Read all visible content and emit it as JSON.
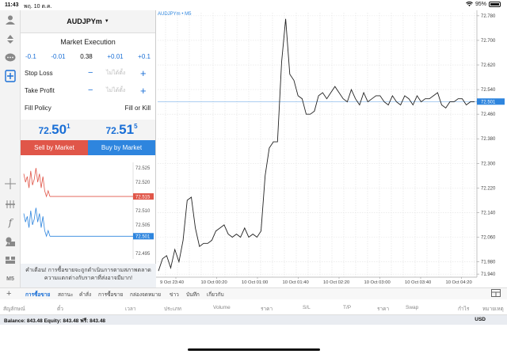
{
  "status": {
    "time": "11:43",
    "date": "พฤ. 10 ต.ค.",
    "battery": "95%"
  },
  "toolbar": {
    "timeframe": "M5"
  },
  "order": {
    "symbol": "AUDJPYm",
    "execution": "Market Execution",
    "volume_steps": [
      "-0.1",
      "-0.01",
      "0.38",
      "+0.01",
      "+0.1"
    ],
    "stop_loss_label": "Stop Loss",
    "take_profit_label": "Take Profit",
    "placeholder": "ไม่ได้ตั้ง",
    "fill_policy_label": "Fill Policy",
    "fill_policy_value": "Fill or Kill",
    "sell_price": {
      "small": "72.",
      "big": "50",
      "sup": "1"
    },
    "buy_price": {
      "small": "72.",
      "big": "51",
      "sup": "5"
    },
    "sell_label": "Sell by Market",
    "buy_label": "Buy by Market",
    "warning": "คำเตือน! การซื้อขายจะถูกดำเนินการตามสภาพตลาด ความแตกต่างกับราคาที่ส่งอาจมีมาก!"
  },
  "mini_chart": {
    "ticks": [
      "72.525",
      "72.520",
      "72.515",
      "72.510",
      "72.505",
      "72.501",
      "72.495"
    ],
    "ask_label": "72.515",
    "bid_label": "72.501",
    "colors": {
      "ask": "#e05649",
      "bid": "#2e85de"
    }
  },
  "chart": {
    "title": "AUDJPYm • M5",
    "y_ticks": [
      "72.780",
      "72.700",
      "72.620",
      "72.540",
      "72.460",
      "72.380",
      "72.300",
      "72.220",
      "72.140",
      "72.060",
      "71.980",
      "71.940"
    ],
    "x_labels": [
      "9 Oct 23:40",
      "10 Oct 00:20",
      "10 Oct 01:00",
      "10 Oct 01:40",
      "10 Oct 02:20",
      "10 Oct 03:00",
      "10 Oct 03:40",
      "10 Oct 04:20"
    ],
    "price_label": "72.501",
    "price_color": "#2e85de"
  },
  "chart_data": {
    "type": "line",
    "title": "AUDJPYm • M5",
    "xlabel": "",
    "ylabel": "",
    "ylim": [
      71.93,
      72.79
    ],
    "last_price": 72.501,
    "x_ticks": [
      "9 Oct 23:40",
      "10 Oct 00:20",
      "10 Oct 01:00",
      "10 Oct 01:40",
      "10 Oct 02:20",
      "10 Oct 03:00",
      "10 Oct 03:40",
      "10 Oct 04:20"
    ],
    "series": [
      {
        "values": [
          71.95,
          71.99,
          72.0,
          71.96,
          72.02,
          71.98,
          72.05,
          72.18,
          72.19,
          72.09,
          72.03,
          72.04,
          72.04,
          72.05,
          72.08,
          72.09,
          72.1,
          72.07,
          72.06,
          72.07,
          72.06,
          72.09,
          72.06,
          72.07,
          72.06,
          72.08,
          72.26,
          72.35,
          72.37,
          72.37,
          72.63,
          72.77,
          72.59,
          72.57,
          72.52,
          72.51,
          72.46,
          72.46,
          72.47,
          72.52,
          72.53,
          72.51,
          72.53,
          72.55,
          72.53,
          72.51,
          72.5,
          72.54,
          72.51,
          72.49,
          72.53,
          72.5,
          72.51,
          72.52,
          72.52,
          72.5,
          72.49,
          72.52,
          72.5,
          72.49,
          72.52,
          72.51,
          72.49,
          72.52,
          72.5,
          72.51,
          72.51,
          72.52,
          72.53,
          72.49,
          72.48,
          72.5,
          72.5,
          72.51,
          72.51,
          72.49,
          72.5,
          72.5
        ]
      }
    ]
  },
  "tabs": [
    "การซื้อขาย",
    "สถานะ",
    "คำสั่ง",
    "การซื้อขาย",
    "กล่องจดหมาย",
    "ข่าว",
    "บันทึก",
    "เกี่ยวกับ"
  ],
  "columns": [
    "สัญลักษณ์",
    "ตั๋ว",
    "เวลา",
    "ประเภท",
    "Volume",
    "ราคา",
    "S/L",
    "T/P",
    "ราคา",
    "Swap",
    "กำไร",
    "หมายเหตุ"
  ],
  "account": {
    "balance_line": "Balance: 843.48 Equity: 843.48 ฟรี: 843.48",
    "currency": "USD"
  }
}
